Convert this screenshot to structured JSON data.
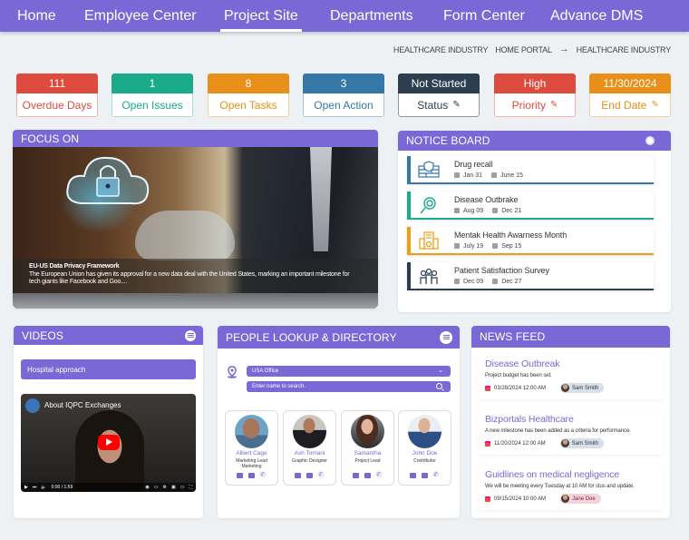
{
  "nav": {
    "items": [
      {
        "label": "Home",
        "active": false
      },
      {
        "label": "Employee Center",
        "active": false
      },
      {
        "label": "Project Site",
        "active": true
      },
      {
        "label": "Departments",
        "active": false
      },
      {
        "label": "Form Center",
        "active": false
      },
      {
        "label": "Advance DMS",
        "active": false
      }
    ]
  },
  "breadcrumb": {
    "current_site": "HEALTHCARE INDUSTRY",
    "home": "HOME PORTAL",
    "arrow": "→",
    "page": "HEALTHCARE INDUSTRY"
  },
  "kpis": [
    {
      "value": "111",
      "label": "Overdue Days",
      "color": "#dd4b3f",
      "editable": false
    },
    {
      "value": "1",
      "label": "Open Issues",
      "color": "#1aab8a",
      "editable": false
    },
    {
      "value": "8",
      "label": "Open Tasks",
      "color": "#e8901a",
      "editable": false
    },
    {
      "value": "3",
      "label": "Open Action",
      "color": "#3578a8",
      "editable": false
    },
    {
      "value": "Not Started",
      "label": "Status",
      "color": "#2c3e50",
      "editable": true
    },
    {
      "value": "High",
      "label": "Priority",
      "color": "#dd4b3f",
      "editable": true
    },
    {
      "value": "11/30/2024",
      "label": "End Date",
      "color": "#e8901a",
      "editable": true
    }
  ],
  "focus": {
    "title": "FOCUS ON",
    "caption_title": "EU-US Data Privacy Framework",
    "caption_text": "The European Union has given its approval for a new data deal with the United States, marking an important milestone for tech giants like Facebook and Goo...."
  },
  "notice_board": {
    "title": "NOTICE BOARD",
    "items": [
      {
        "title": "Drug recall",
        "start": "Jan 31",
        "end": "June 15",
        "color": "#3578a8",
        "icon": "firewall-shield-icon"
      },
      {
        "title": "Disease Outbrake",
        "start": "Aug 09",
        "end": "Dec 21",
        "color": "#1aab8a",
        "icon": "virus-search-icon"
      },
      {
        "title": "Mentak Health Awarness Month",
        "start": "July 19",
        "end": "Sep 15",
        "color": "#f39c12",
        "icon": "hospital-building-icon"
      },
      {
        "title": "Patient Satisfaction Survey",
        "start": "Dec 09",
        "end": "Dec 27",
        "color": "#2c3e50",
        "icon": "people-group-icon"
      }
    ]
  },
  "videos": {
    "title": "VIDEOS",
    "selected": "Hospital approach",
    "video_title": "About IQPC Exchanges",
    "time": "0:00 / 1:59"
  },
  "people": {
    "title": "PEOPLE LOOKUP & DIRECTORY",
    "office": "USA Office",
    "search_placeholder": "Enter name to search.",
    "list": [
      {
        "name": "Albert Cage",
        "role": "Marketing Lead Marketing"
      },
      {
        "name": "Ash Tomani",
        "role": "Graphic Designer"
      },
      {
        "name": "Samantha",
        "role": "Project Lead"
      },
      {
        "name": "John Doe",
        "role": "Contributor"
      }
    ]
  },
  "news": {
    "title": "NEWS FEED",
    "items": [
      {
        "title": "Disease Outbreak",
        "desc": "Project budget has been set.",
        "date": "03/28/2024 12:00 AM",
        "author": "Sam Smith",
        "chip_color": "#d6e0ea"
      },
      {
        "title": "Bizportals Healthcare",
        "desc": "A new milestone has been added as a criteria for performance.",
        "date": "11/20/2024 12:00 AM",
        "author": "Sam Smith",
        "chip_color": "#d6e0ea"
      },
      {
        "title": "Guidlines on medical negligence",
        "desc": "We will be meeting every Tuesday at 10 AM for stus and update.",
        "date": "09/15/2024 10:00 AM",
        "author": "Jane Doe",
        "chip_color": "#f2d4dc"
      }
    ]
  }
}
